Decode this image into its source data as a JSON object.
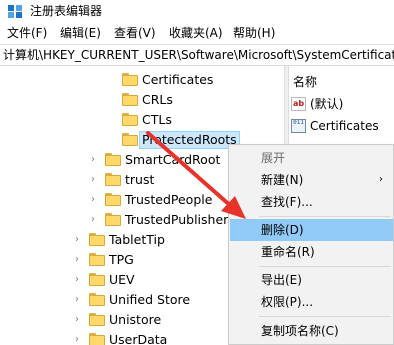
{
  "window": {
    "title": "注册表编辑器"
  },
  "menu": [
    "文件(F)",
    "编辑(E)",
    "查看(V)",
    "收藏夹(A)",
    "帮助(H)"
  ],
  "address": "计算机\\HKEY_CURRENT_USER\\Software\\Microsoft\\SystemCertificates\\Root",
  "tree": {
    "items": [
      {
        "label": "Certificates",
        "expandable": false,
        "selected": false
      },
      {
        "label": "CRLs",
        "expandable": false,
        "selected": false
      },
      {
        "label": "CTLs",
        "expandable": false,
        "selected": false
      },
      {
        "label": "ProtectedRoots",
        "expandable": false,
        "selected": true
      },
      {
        "label": "SmartCardRoot",
        "expandable": true,
        "selected": false
      },
      {
        "label": "trust",
        "expandable": true,
        "selected": false
      },
      {
        "label": "TrustedPeople",
        "expandable": true,
        "selected": false
      },
      {
        "label": "TrustedPublisher",
        "expandable": true,
        "selected": false
      },
      {
        "label": "TabletTip",
        "expandable": true,
        "selected": false
      },
      {
        "label": "TPG",
        "expandable": true,
        "selected": false
      },
      {
        "label": "UEV",
        "expandable": true,
        "selected": false
      },
      {
        "label": "Unified Store",
        "expandable": true,
        "selected": false
      },
      {
        "label": "Unistore",
        "expandable": true,
        "selected": false
      },
      {
        "label": "UserData",
        "expandable": true,
        "selected": false
      }
    ]
  },
  "list": {
    "header": "名称",
    "rows": [
      {
        "icon": "string-value-icon",
        "icon_text": "ab",
        "name": "(默认)"
      },
      {
        "icon": "binary-value-icon",
        "icon_text": "011",
        "name": "Certificates"
      }
    ]
  },
  "context_menu": {
    "items": [
      {
        "label": "展开",
        "type": "header"
      },
      {
        "label": "新建(N)",
        "submenu": true
      },
      {
        "label": "查找(F)..."
      },
      {
        "label": "删除(D)",
        "highlighted": true
      },
      {
        "label": "重命名(R)"
      },
      {
        "label": "导出(E)"
      },
      {
        "label": "权限(P)..."
      },
      {
        "label": "复制项名称(C)"
      }
    ],
    "submenu_arrow": "›"
  },
  "colors": {
    "selection_bg": "#cce8ff",
    "menu_highlight": "#91c9f7",
    "folder_yellow": "#ffd86a",
    "annotation_arrow": "#e8332a"
  }
}
